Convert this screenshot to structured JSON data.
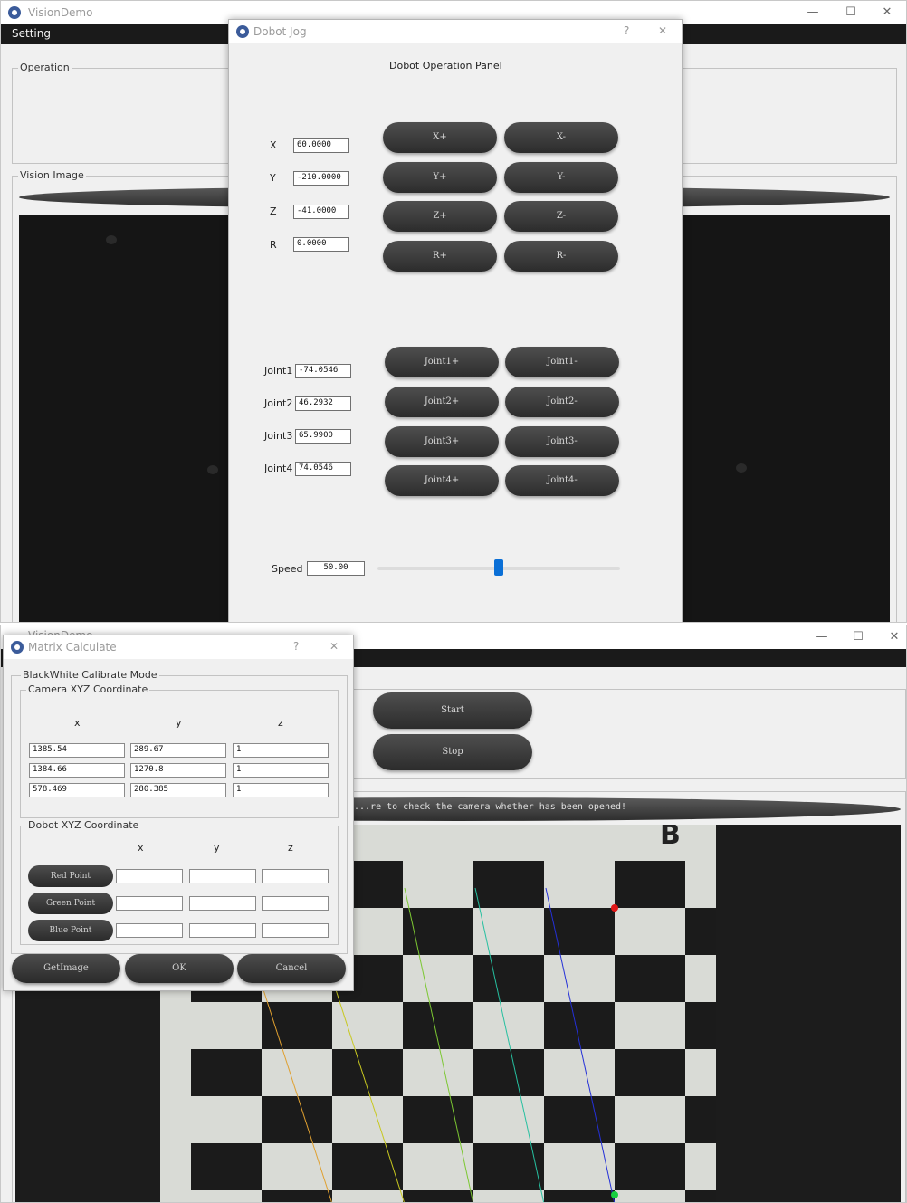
{
  "top": {
    "window": {
      "title": "VisionDemo",
      "menu": "Setting",
      "group_operation": "Operation",
      "group_vision": "Vision Image"
    },
    "dobot_jog": {
      "title": "Dobot Jog",
      "help": "?",
      "close": "✕",
      "panel_title": "Dobot Operation Panel",
      "coords": [
        {
          "label": "X",
          "value": "60.0000"
        },
        {
          "label": "Y",
          "value": "-210.0000"
        },
        {
          "label": "Z",
          "value": "-41.0000"
        },
        {
          "label": "R",
          "value": "0.0000"
        }
      ],
      "axis_buttons": [
        [
          "X+",
          "X-"
        ],
        [
          "Y+",
          "Y-"
        ],
        [
          "Z+",
          "Z-"
        ],
        [
          "R+",
          "R-"
        ]
      ],
      "joints": [
        {
          "label": "Joint1",
          "value": "-74.0546"
        },
        {
          "label": "Joint2",
          "value": "46.2932"
        },
        {
          "label": "Joint3",
          "value": "65.9900"
        },
        {
          "label": "Joint4",
          "value": "74.0546"
        }
      ],
      "joint_buttons": [
        [
          "Joint1+",
          "Joint1-"
        ],
        [
          "Joint2+",
          "Joint2-"
        ],
        [
          "Joint3+",
          "Joint3-"
        ],
        [
          "Joint4+",
          "Joint4-"
        ]
      ],
      "speed_label": "Speed",
      "speed_value": "50.00",
      "speed_fraction": 0.5
    }
  },
  "bottom": {
    "window": {
      "title": "VisionDemo",
      "start": "Start",
      "stop": "Stop",
      "status": "...re to check the camera whether has been opened!"
    },
    "checker_label": "B",
    "matrix": {
      "title": "Matrix Calculate",
      "help": "?",
      "close": "✕",
      "mode_group": "BlackWhite Calibrate Mode",
      "camera_group": "Camera XYZ Coordinate",
      "camera_headers": [
        "x",
        "y",
        "z"
      ],
      "camera_rows": [
        [
          "1385.54",
          "289.67",
          "1"
        ],
        [
          "1384.66",
          "1270.8",
          "1"
        ],
        [
          "578.469",
          "280.385",
          "1"
        ]
      ],
      "dobot_group": "Dobot XYZ Coordinate",
      "dobot_headers": [
        "x",
        "y",
        "z"
      ],
      "dobot_rows": [
        {
          "button": "Red Point",
          "values": [
            "",
            "",
            ""
          ]
        },
        {
          "button": "Green Point",
          "values": [
            "",
            "",
            ""
          ]
        },
        {
          "button": "Blue Point",
          "values": [
            "",
            "",
            ""
          ]
        }
      ],
      "footer": {
        "getimage": "GetImage",
        "ok": "OK",
        "cancel": "Cancel"
      }
    }
  },
  "icons": {
    "minimize": "—",
    "maximize": "☐",
    "close": "✕"
  }
}
